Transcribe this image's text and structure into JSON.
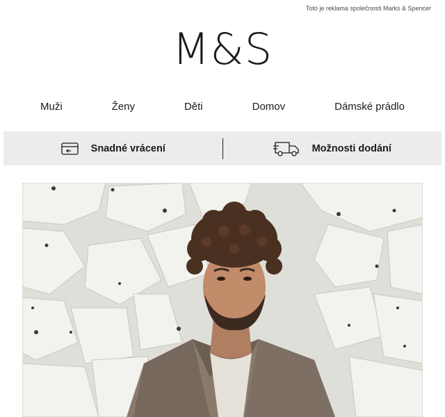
{
  "ad_note": "Toto je reklama společnosti Marks & Spencer",
  "logo": "M&S",
  "nav": {
    "items": [
      {
        "label": "Muži"
      },
      {
        "label": "Ženy"
      },
      {
        "label": "Děti"
      },
      {
        "label": "Domov"
      },
      {
        "label": "Dámské prádlo"
      }
    ]
  },
  "services": {
    "returns": {
      "label": "Snadné vrácení",
      "icon": "return-card-icon"
    },
    "delivery": {
      "label": "Možnosti dodání",
      "icon": "delivery-truck-icon"
    }
  },
  "colors": {
    "service_bar_bg": "#ececec",
    "text": "#1a1a1a"
  }
}
